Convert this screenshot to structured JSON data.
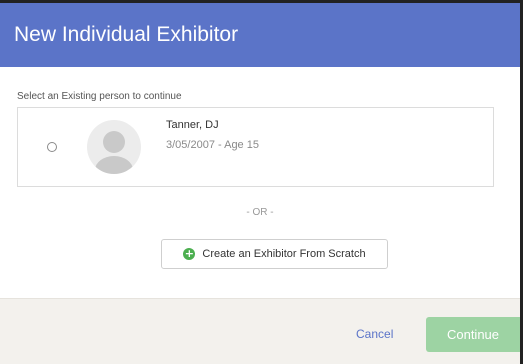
{
  "dialog": {
    "title": "New Individual Exhibitor",
    "prompt": "Select an Existing person to continue",
    "person": {
      "name": "Tanner, DJ",
      "meta": "3/05/2007 - Age 15"
    },
    "or_text": "- OR -",
    "create_label": "Create an Exhibitor From Scratch",
    "cancel_label": "Cancel",
    "continue_label": "Continue"
  },
  "icons": {
    "plus": "plus-circle-icon",
    "avatar": "person-silhouette-icon"
  },
  "colors": {
    "header": "#5b74c8",
    "continue_disabled": "#9dd3a3",
    "link": "#5b74c8",
    "plus": "#4caf50",
    "footer": "#f3f1ed"
  }
}
